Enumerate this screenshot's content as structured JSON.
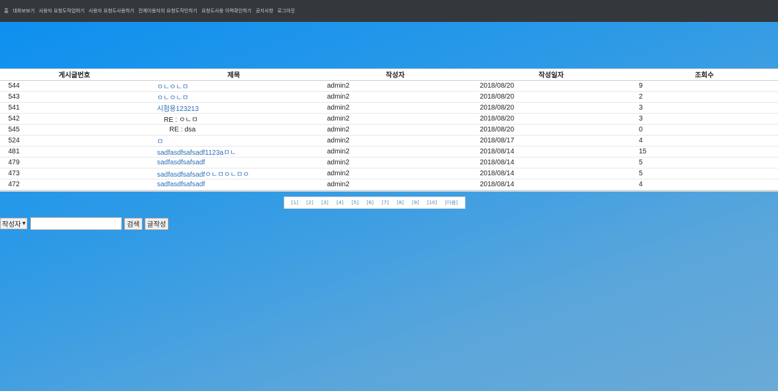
{
  "nav": {
    "items": [
      "홈",
      "대화보보기",
      "사용자 요청도작업하기",
      "사용자 요청도사용하기",
      "전체이용자의 요청도작인하기",
      "요청도사용 이력확인하기",
      "공지사항",
      "로그아웃"
    ]
  },
  "table": {
    "headers": [
      "게시글번호",
      "제목",
      "작성자",
      "작성일자",
      "조회수"
    ],
    "rows": [
      {
        "no": "544",
        "title": "ㅇㄴㅇㄴㅁ",
        "indent": 0,
        "author": "admin2",
        "date": "2018/08/20",
        "views": "9"
      },
      {
        "no": "543",
        "title": "ㅇㄴㅇㄴㅁ",
        "indent": 0,
        "author": "admin2",
        "date": "2018/08/20",
        "views": "2"
      },
      {
        "no": "541",
        "title": "시험용123213",
        "indent": 0,
        "author": "admin2",
        "date": "2018/08/20",
        "views": "3"
      },
      {
        "no": "542",
        "title": "RE : ㅇㄴㅁ",
        "indent": 1,
        "author": "admin2",
        "date": "2018/08/20",
        "views": "3"
      },
      {
        "no": "545",
        "title": "RE : dsa",
        "indent": 2,
        "author": "admin2",
        "date": "2018/08/20",
        "views": "0"
      },
      {
        "no": "524",
        "title": "ㅁ",
        "indent": 0,
        "author": "admin2",
        "date": "2018/08/17",
        "views": "4"
      },
      {
        "no": "481",
        "title": "sadfasdfsafsadf1123aㅁㄴ",
        "indent": 0,
        "author": "admin2",
        "date": "2018/08/14",
        "views": "15"
      },
      {
        "no": "479",
        "title": "sadfasdfsafsadf",
        "indent": 0,
        "author": "admin2",
        "date": "2018/08/14",
        "views": "5"
      },
      {
        "no": "473",
        "title": "sadfasdfsafsadfㅇㄴㅁㅇㄴㅁㅇ",
        "indent": 0,
        "author": "admin2",
        "date": "2018/08/14",
        "views": "5"
      },
      {
        "no": "472",
        "title": "sadfasdfsafsadf",
        "indent": 0,
        "author": "admin2",
        "date": "2018/08/14",
        "views": "4"
      }
    ]
  },
  "pager": {
    "pages": [
      "[1]",
      "[2]",
      "[3]",
      "[4]",
      "[5]",
      "[6]",
      "[7]",
      "[8]",
      "[9]",
      "[10]",
      "[다음]"
    ]
  },
  "search": {
    "field_selected": "작성자",
    "query": "",
    "search_label": "검색",
    "write_label": "글작성"
  },
  "colors": {
    "topbar": "#34373b",
    "link": "#2c6db7",
    "bg_top": "#0a8ff0",
    "bg_bottom": "#6aaad6"
  }
}
